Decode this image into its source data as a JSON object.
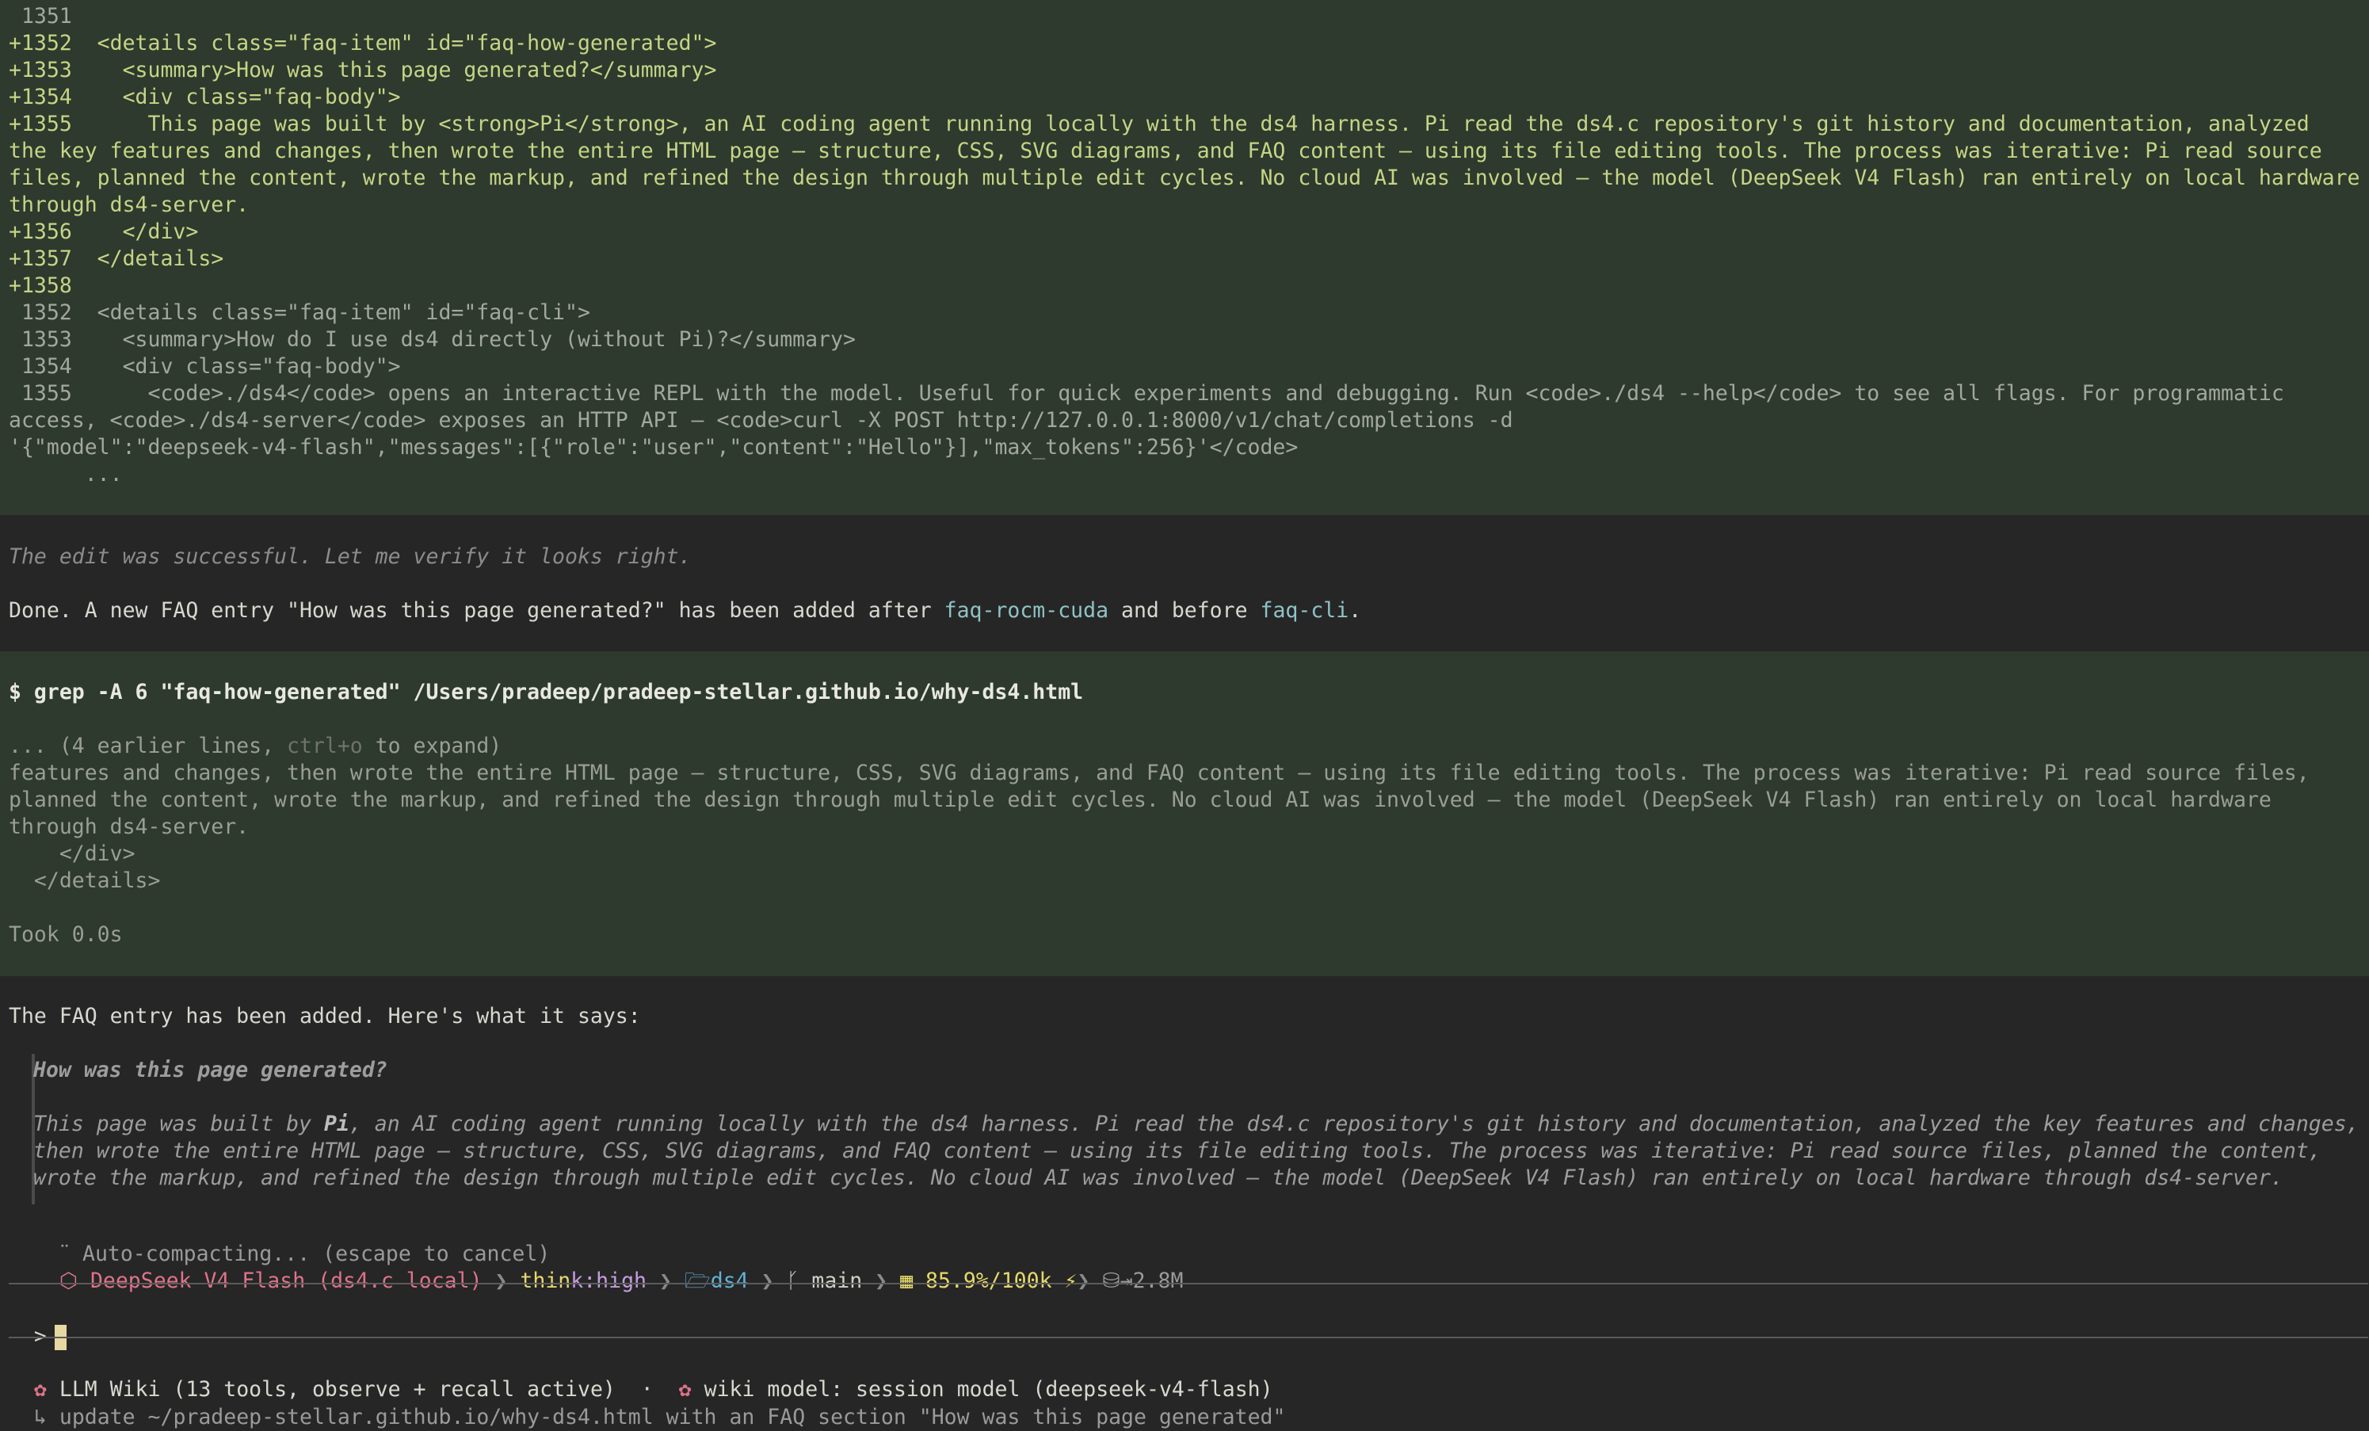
{
  "diff": {
    "lines": [
      {
        "n": " 1351",
        "t": ""
      },
      {
        "n": "+1352",
        "t": "  <details class=\"faq-item\" id=\"faq-how-generated\">"
      },
      {
        "n": "+1353",
        "t": "    <summary>How was this page generated?</summary>"
      },
      {
        "n": "+1354",
        "t": "    <div class=\"faq-body\">"
      },
      {
        "n": "+1355",
        "t": "      This page was built by <strong>Pi</strong>, an AI coding agent running locally with the ds4 harness. Pi read the ds4.c repository's git history and documentation, analyzed"
      },
      {
        "n": "",
        "t": "the key features and changes, then wrote the entire HTML page — structure, CSS, SVG diagrams, and FAQ content — using its file editing tools. The process was iterative: Pi read source"
      },
      {
        "n": "",
        "t": "files, planned the content, wrote the markup, and refined the design through multiple edit cycles. No cloud AI was involved — the model (DeepSeek V4 Flash) ran entirely on local hardware"
      },
      {
        "n": "",
        "t": "through ds4-server."
      },
      {
        "n": "+1356",
        "t": "    </div>"
      },
      {
        "n": "+1357",
        "t": "  </details>"
      },
      {
        "n": "+1358",
        "t": ""
      },
      {
        "n": " 1352",
        "t": "  <details class=\"faq-item\" id=\"faq-cli\">"
      },
      {
        "n": " 1353",
        "t": "    <summary>How do I use ds4 directly (without Pi)?</summary>"
      },
      {
        "n": " 1354",
        "t": "    <div class=\"faq-body\">"
      },
      {
        "n": " 1355",
        "t": "      <code>./ds4</code> opens an interactive REPL with the model. Useful for quick experiments and debugging. Run <code>./ds4 --help</code> to see all flags. For programmatic"
      },
      {
        "n": "",
        "t": "access, <code>./ds4-server</code> exposes an HTTP API — <code>curl -X POST http://127.0.0.1:8000/v1/chat/completions -d"
      },
      {
        "n": "",
        "t": "'{\"model\":\"deepseek-v4-flash\",\"messages\":[{\"role\":\"user\",\"content\":\"Hello\"}],\"max_tokens\":256}'</code>"
      },
      {
        "n": "",
        "t": "      ..."
      }
    ]
  },
  "assistant1": {
    "thinking": "The edit was successful. Let me verify it looks right.",
    "done_a": "Done. A new FAQ entry \"How was this page generated?\" has been added after ",
    "code1": "faq-rocm-cuda",
    "done_b": " and before ",
    "code2": "faq-cli",
    "done_c": "."
  },
  "tool": {
    "command": "$ grep -A 6 \"faq-how-generated\" /Users/pradeep/pradeep-stellar.github.io/why-ds4.html",
    "collapsed_a": "... (4 earlier lines, ",
    "collapsed_key": "ctrl+o",
    "collapsed_b": " to expand)",
    "output": [
      "features and changes, then wrote the entire HTML page — structure, CSS, SVG diagrams, and FAQ content — using its file editing tools. The process was iterative: Pi read source files,",
      "planned the content, wrote the markup, and refined the design through multiple edit cycles. No cloud AI was involved — the model (DeepSeek V4 Flash) ran entirely on local hardware",
      "through ds4-server.",
      "    </div>",
      "  </details>"
    ],
    "took": "Took 0.0s"
  },
  "assistant2": {
    "intro": "The FAQ entry has been added. Here's what it says:",
    "quote_title": "How was this page generated?",
    "quote_a": "This page was built by ",
    "quote_bold": "Pi",
    "quote_b": ", an AI coding agent running locally with the ds4 harness. Pi read the ds4.c repository's git history and documentation, analyzed the key features and changes,",
    "quote_lines": [
      "then wrote the entire HTML page — structure, CSS, SVG diagrams, and FAQ content — using its file editing tools. The process was iterative: Pi read source files, planned the content,",
      "wrote the markup, and refined the design through multiple edit cycles. No cloud AI was involved — the model (DeepSeek V4 Flash) ran entirely on local hardware through ds4-server."
    ]
  },
  "status": {
    "compacting": "Auto-compacting... (escape to cancel)",
    "model": "DeepSeek V4 Flash (ds4.c local)",
    "think_a": "thin",
    "think_b": "k:",
    "think_level": "high",
    "folder": "ds4",
    "branch": "main",
    "context": "85.9%/100k",
    "tokens": "2.8M",
    "colors": {
      "model": "#e0738a",
      "think": "#c49de0",
      "folder": "#5fb3d9",
      "context": "#e6d96a"
    }
  },
  "prompt": {
    "symbol": ">"
  },
  "footer": {
    "wiki": "LLM Wiki (13 tools, observe + recall active)",
    "dot": "·",
    "wiki_model": "wiki model: session model (deepseek-v4-flash)",
    "task": "update ~/pradeep-stellar.github.io/why-ds4.html with an FAQ section \"How was this page generated\""
  }
}
